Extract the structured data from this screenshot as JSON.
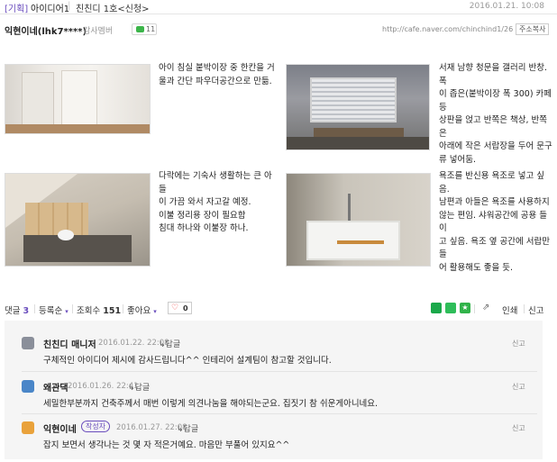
{
  "header": {
    "category": "[기획]",
    "title": "아이디어1",
    "separator": "|",
    "board": "친친디 1호<신청>",
    "date": "2016.01.21. 10:08"
  },
  "author": {
    "nickname": "익현이네(lhk7****)",
    "grade": "감사멤버",
    "chat_count": "11",
    "url": "http://cafe.naver.com/chinchind1/26",
    "copy_label": "주소복사"
  },
  "photos": [
    {
      "icon": "bedroom-closet-photo",
      "caption": "아이 침실 붙박이장 중 한칸을 거\n울과 간단 파우더공간으로 만듦."
    },
    {
      "icon": "study-window-photo",
      "caption": "서재 남향 청문을 갤러리 반창. 폭\n이 좁은(붙박이장 폭 300) 카페등\n상판을 얹고 반쪽은 책상, 반쪽은\n아래에 작은 서랍장을 두어 문구\n류 넣어둠."
    },
    {
      "icon": "attic-room-photo",
      "caption": "다락에는 기숙사 생활하는 큰 아들\n이 가끔 와서 자고갈 예정.\n이불 정리용 장이 필요함\n침대 하나와 이불장 하나."
    },
    {
      "icon": "bathtub-photo",
      "caption": "욕조를 반신용 욕조로 넣고 싶음.\n남편과 아들은 욕조를 사용하지\n않는 편임. 샤워공간에 공용 들이\n고 싶음. 욕조 옆 공간에 서랍만들\n어 활용해도 좋을 듯."
    }
  ],
  "stats": {
    "comments_label": "댓글",
    "comments_count": "3",
    "sort_label": "등록순",
    "views_label": "조회수",
    "views_count": "151",
    "like_label": "좋아요",
    "like_count": "0",
    "print_label": "인쇄",
    "report_label": "신고"
  },
  "comments": [
    {
      "name": "친친디 매니저",
      "date": "2016.01.22. 22:08",
      "reply": "답글",
      "text": "구체적인 아이디어 제시에 감사드립니다^^ 인테리어 설계팀이 참고할 것입니다.",
      "report": "신고",
      "badge": ""
    },
    {
      "name": "왜관댁",
      "date": "2016.01.26. 22:41",
      "reply": "답글",
      "text": "세밀한부분까지 건축주께서 매번 이렇게 의견나눔을 해야되는군요. 집짓기 참 쉬운게아니네요.",
      "report": "신고",
      "badge": ""
    },
    {
      "name": "익현이네",
      "date": "2016.01.27. 22:08",
      "reply": "답글",
      "text": "잡지 보면서 생각나는 것 몇 자 적은거예요. 마음만 부풀어 있지요^^",
      "report": "신고",
      "badge": "작성자"
    }
  ],
  "colors": {
    "accent": "#6a4dbd",
    "like_heart": "#e33333",
    "chat_green": "#3cb54a"
  }
}
